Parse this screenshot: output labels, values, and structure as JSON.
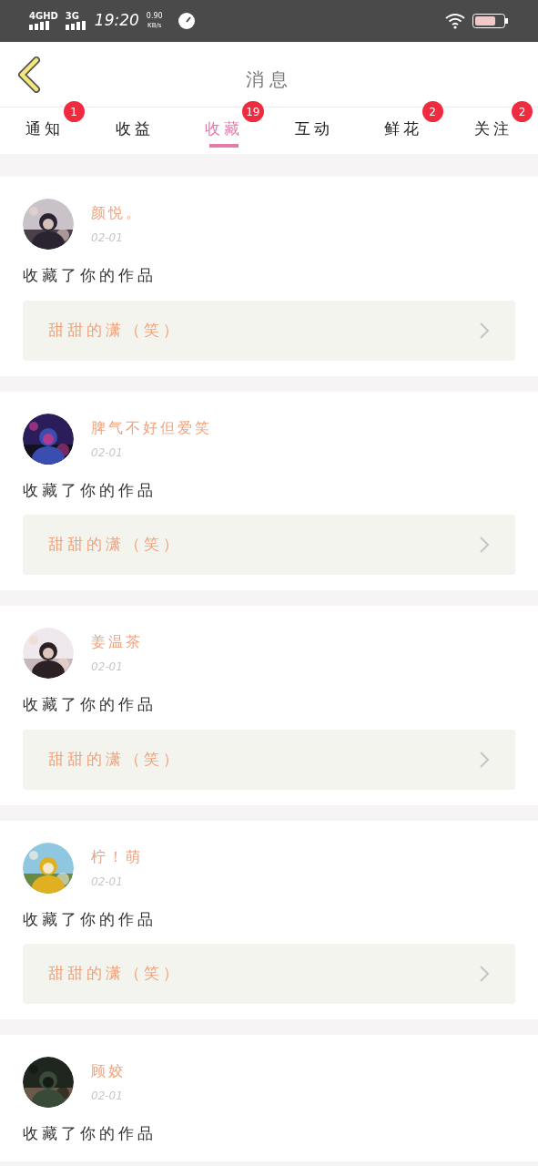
{
  "status_bar": {
    "network_1": "4GHD",
    "network_2": "3G",
    "time": "19:20",
    "speed": "0.90",
    "speed_unit": "KB/s"
  },
  "header": {
    "title": "消息"
  },
  "tabs": [
    {
      "label": "通知",
      "badge": "1",
      "selected": false
    },
    {
      "label": "收益",
      "selected": false
    },
    {
      "label": "收藏",
      "badge": "19",
      "selected": true
    },
    {
      "label": "互动",
      "selected": false
    },
    {
      "label": "鲜花",
      "badge": "2",
      "selected": false
    },
    {
      "label": "关注",
      "badge": "2",
      "selected": false
    }
  ],
  "messages": [
    {
      "name": "颜悦。",
      "date": "02-01",
      "text": "收藏了你的作品",
      "work": "甜甜的潇（笑）"
    },
    {
      "name": "脾气不好但爱笑",
      "date": "02-01",
      "text": "收藏了你的作品",
      "work": "甜甜的潇（笑）"
    },
    {
      "name": "姜温茶",
      "date": "02-01",
      "text": "收藏了你的作品",
      "work": "甜甜的潇（笑）"
    },
    {
      "name": "柠！萌",
      "date": "02-01",
      "text": "收藏了你的作品",
      "work": "甜甜的潇（笑）"
    },
    {
      "name": "顾姣",
      "date": "02-01",
      "text": "收藏了你的作品"
    }
  ]
}
